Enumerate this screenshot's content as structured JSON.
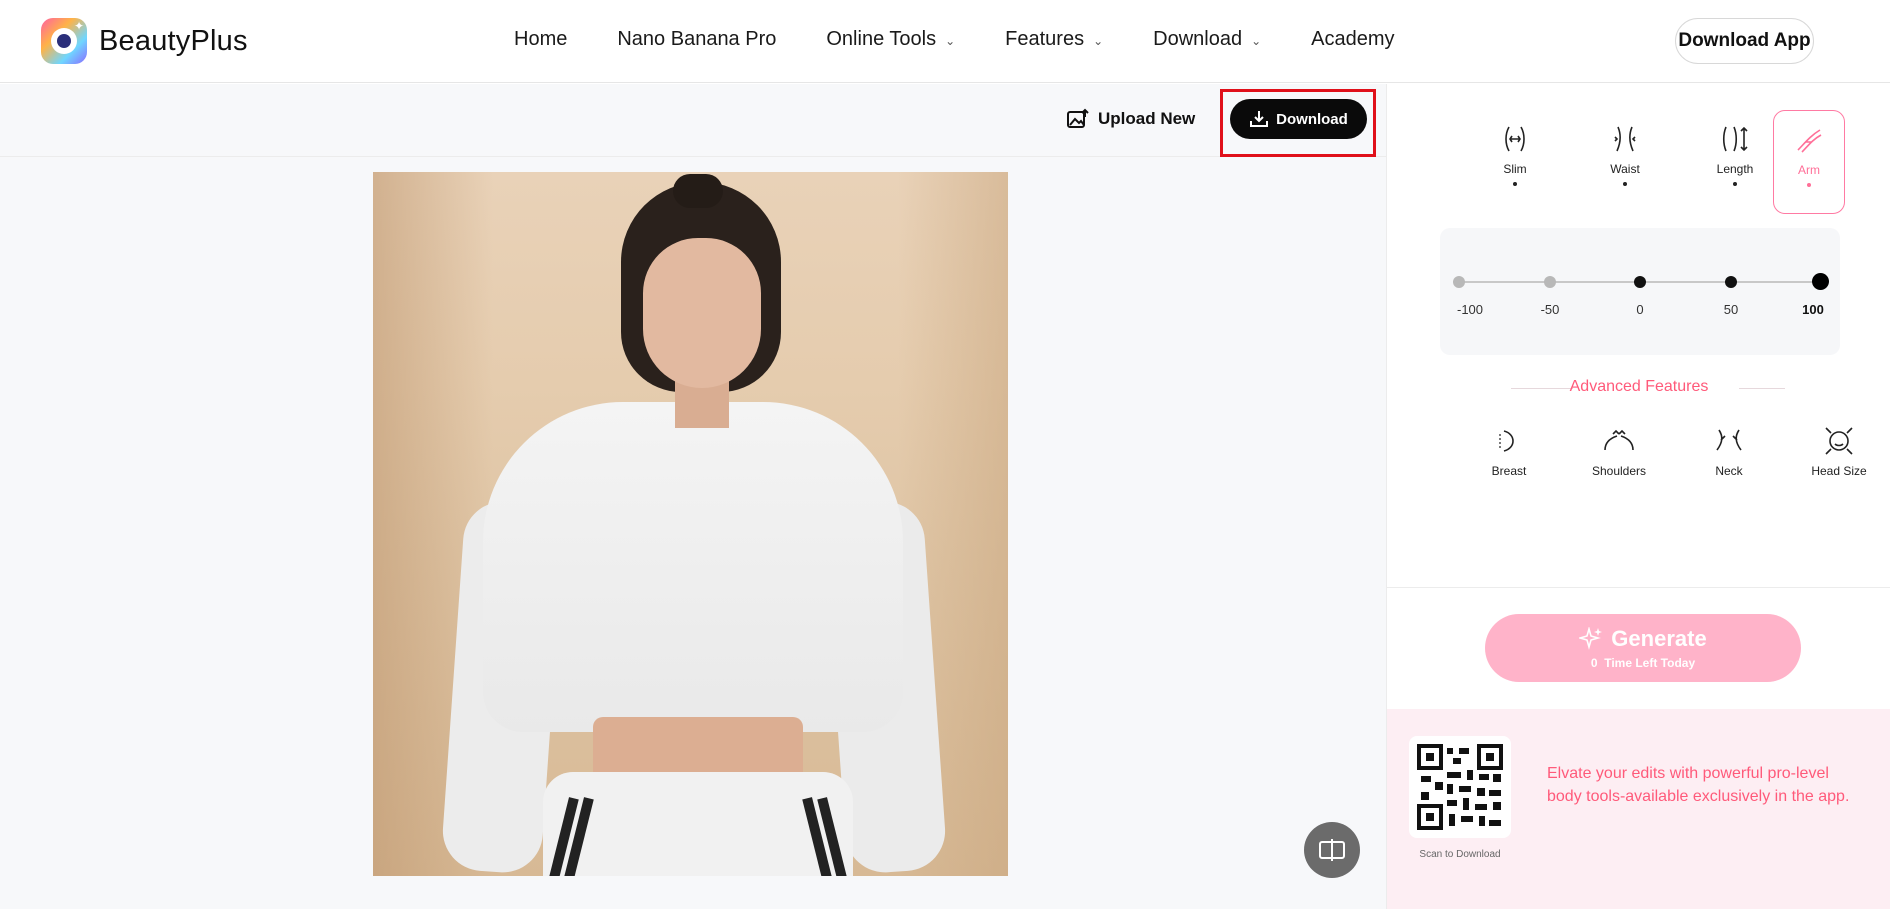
{
  "app": {
    "name": "BeautyPlus"
  },
  "nav": {
    "items": [
      {
        "label": "Home",
        "dropdown": false
      },
      {
        "label": "Nano Banana Pro",
        "dropdown": false
      },
      {
        "label": "Online Tools",
        "dropdown": true
      },
      {
        "label": "Features",
        "dropdown": true
      },
      {
        "label": "Download",
        "dropdown": true
      },
      {
        "label": "Academy",
        "dropdown": false
      }
    ],
    "download_app": "Download App"
  },
  "toolbar": {
    "upload_new": "Upload New",
    "download": "Download"
  },
  "tools": {
    "items": [
      {
        "label": "Slim",
        "icon": "slim-body-icon",
        "active": false
      },
      {
        "label": "Waist",
        "icon": "waist-icon",
        "active": false
      },
      {
        "label": "Length",
        "icon": "length-icon",
        "active": false
      },
      {
        "label": "Arm",
        "icon": "arm-icon",
        "active": true
      }
    ]
  },
  "slider": {
    "stops": [
      "-100",
      "-50",
      "0",
      "50",
      "100"
    ],
    "value": 100
  },
  "advanced": {
    "title": "Advanced Features",
    "items": [
      {
        "label": "Breast",
        "icon": "breast-icon"
      },
      {
        "label": "Shoulders",
        "icon": "shoulders-icon"
      },
      {
        "label": "Neck",
        "icon": "neck-icon"
      },
      {
        "label": "Head Size",
        "icon": "head-size-icon"
      }
    ]
  },
  "generate": {
    "label": "Generate",
    "count": "0",
    "remaining": "Time Left Today"
  },
  "promo": {
    "qr_caption": "Scan to Download",
    "text": "Elvate your edits with powerful pro-level body tools-available exclusively in the app."
  },
  "colors": {
    "accent": "#ff5a7a",
    "generate_bg": "#ffb3c9",
    "download_highlight": "#e0101a"
  }
}
